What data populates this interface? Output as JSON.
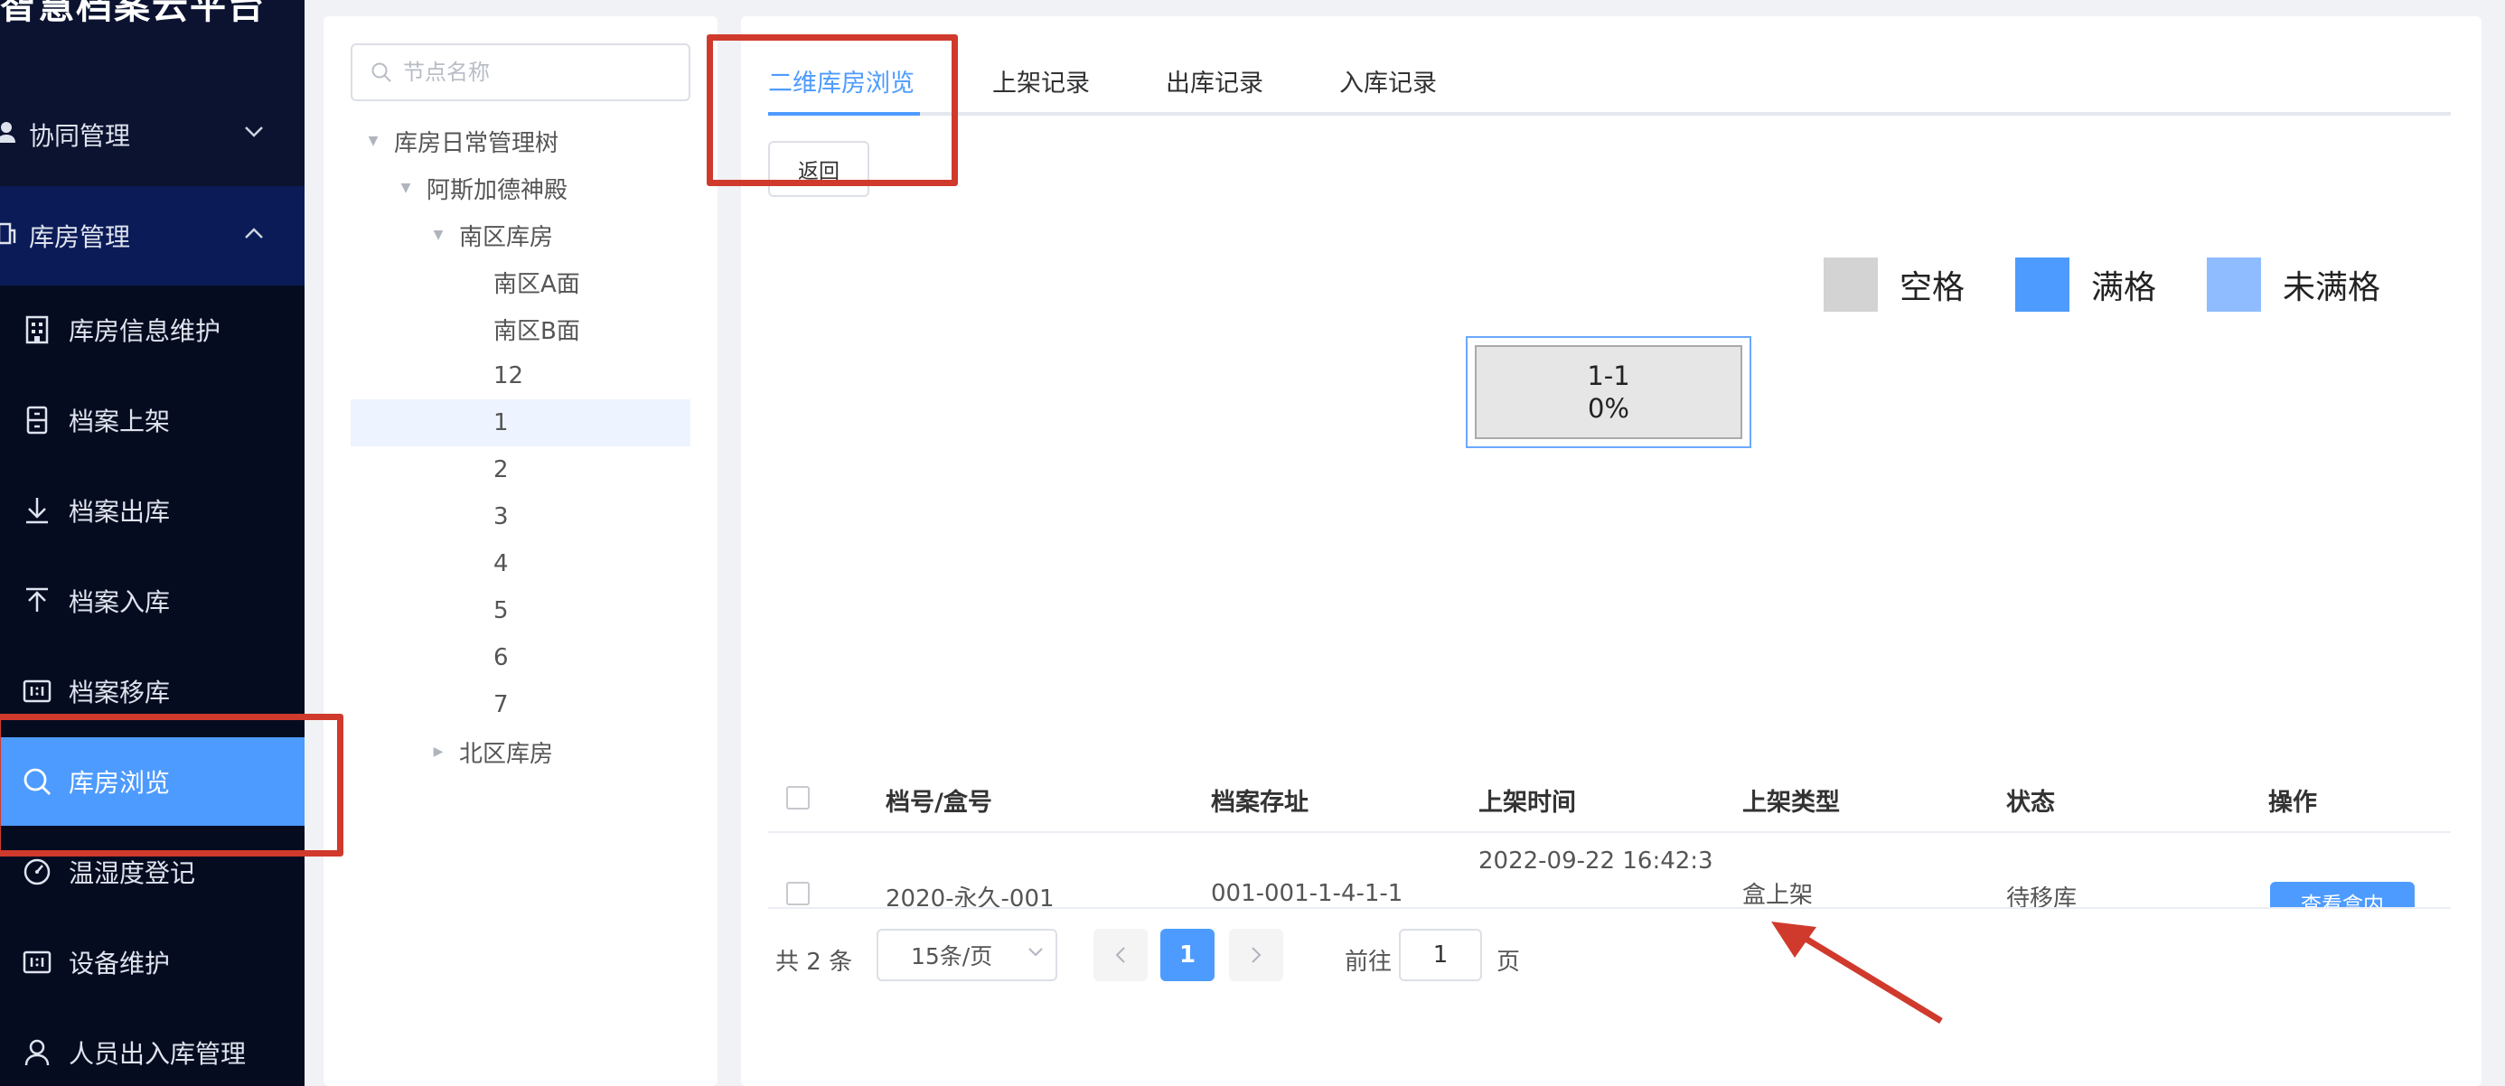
{
  "app": {
    "title": "智慧档案云平台"
  },
  "sidebar": {
    "groups": [
      {
        "label": "协同管理",
        "icon": "user-icon",
        "expanded": false
      },
      {
        "label": "库房管理",
        "icon": "building-icon",
        "expanded": true
      }
    ],
    "items": [
      {
        "label": "库房信息维护",
        "icon": "building-icon"
      },
      {
        "label": "档案上架",
        "icon": "cabinet-icon"
      },
      {
        "label": "档案出库",
        "icon": "download-icon"
      },
      {
        "label": "档案入库",
        "icon": "upload-icon"
      },
      {
        "label": "档案移库",
        "icon": "transfer-icon"
      },
      {
        "label": "库房浏览",
        "icon": "search-icon",
        "active": true
      },
      {
        "label": "温湿度登记",
        "icon": "gauge-icon"
      },
      {
        "label": "设备维护",
        "icon": "device-icon"
      },
      {
        "label": "人员出入库管理",
        "icon": "user-icon"
      }
    ],
    "active_color": "#4d9bff"
  },
  "tree": {
    "search_placeholder": "节点名称",
    "nodes": [
      {
        "label": "库房日常管理树",
        "level": 0,
        "expanded": true
      },
      {
        "label": "阿斯加德神殿",
        "level": 1,
        "expanded": true
      },
      {
        "label": "南区库房",
        "level": 2,
        "expanded": true
      },
      {
        "label": "南区A面",
        "level": 3
      },
      {
        "label": "南区B面",
        "level": 3
      },
      {
        "label": "12",
        "level": 3
      },
      {
        "label": "1",
        "level": 3,
        "selected": true
      },
      {
        "label": "2",
        "level": 3
      },
      {
        "label": "3",
        "level": 3
      },
      {
        "label": "4",
        "level": 3
      },
      {
        "label": "5",
        "level": 3
      },
      {
        "label": "6",
        "level": 3
      },
      {
        "label": "7",
        "level": 3
      },
      {
        "label": "北区库房",
        "level": 2,
        "expanded": false
      }
    ]
  },
  "main": {
    "tabs": [
      {
        "label": "二维库房浏览",
        "active": true
      },
      {
        "label": "上架记录"
      },
      {
        "label": "出库记录"
      },
      {
        "label": "入库记录"
      }
    ],
    "back_label": "返回",
    "legend": [
      {
        "label": "空格",
        "color": "#d3d3d3"
      },
      {
        "label": "满格",
        "color": "#4d9bff"
      },
      {
        "label": "未满格",
        "color": "#8fbcff"
      }
    ],
    "cells": [
      {
        "name": "1-1",
        "percent": "0%"
      }
    ],
    "table": {
      "columns": [
        "档号/盒号",
        "档案存址",
        "上架时间",
        "上架类型",
        "状态",
        "操作"
      ],
      "rows": [
        {
          "number": "2020-永久-001",
          "location": "001-001-1-4-1-1",
          "time": "2022-09-22 16:42:3",
          "type": "盒上架",
          "status": "待移库",
          "action": "查看盒内"
        }
      ]
    },
    "pagination": {
      "total_text": "共 2 条",
      "page_size": "15条/页",
      "current_page": "1",
      "goto_prefix": "前往",
      "goto_value": "1",
      "goto_suffix": "页"
    }
  },
  "annotation_color": "#d03a2c"
}
